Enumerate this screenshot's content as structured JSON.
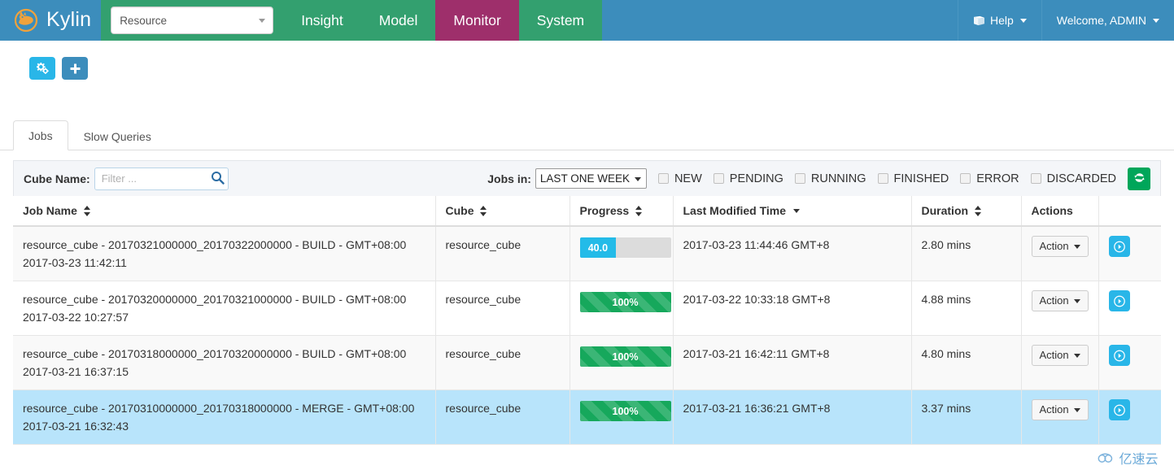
{
  "header": {
    "brand": "Kylin",
    "logo_icon": "kylin-logo-icon",
    "project_selector": {
      "value": "Resource",
      "caret_icon": "chevron-down-icon"
    },
    "nav_links": [
      {
        "label": "Insight",
        "active": false
      },
      {
        "label": "Model",
        "active": false
      },
      {
        "label": "Monitor",
        "active": true
      },
      {
        "label": "System",
        "active": false
      }
    ],
    "help": {
      "label": "Help",
      "icon": "book-icon",
      "caret_icon": "caret-down-icon"
    },
    "user": {
      "label": "Welcome, ADMIN",
      "caret_icon": "caret-down-icon"
    },
    "colors": {
      "navbar_bg": "#3c8dbc",
      "nav_item_bg": "#33a06f",
      "nav_active_bg": "#9e2f6b"
    }
  },
  "toolbar": {
    "buttons": [
      {
        "icon": "cogs-icon",
        "color": "#29b6e8",
        "name": "settings-button"
      },
      {
        "icon": "plus-icon",
        "color": "#3c8dbc",
        "name": "add-button"
      }
    ]
  },
  "tabs": [
    {
      "label": "Jobs",
      "active": true
    },
    {
      "label": "Slow Queries",
      "active": false
    }
  ],
  "filters": {
    "cube_name_label": "Cube Name:",
    "cube_name_value": "",
    "cube_name_placeholder": "Filter ...",
    "search_icon": "search-icon",
    "jobs_in_label": "Jobs in:",
    "jobs_in_value": "LAST ONE WEEK",
    "jobs_in_options": [
      "LAST ONE WEEK"
    ],
    "status_checkboxes": [
      {
        "label": "NEW",
        "checked": false
      },
      {
        "label": "PENDING",
        "checked": false
      },
      {
        "label": "RUNNING",
        "checked": false
      },
      {
        "label": "FINISHED",
        "checked": false
      },
      {
        "label": "ERROR",
        "checked": false
      },
      {
        "label": "DISCARDED",
        "checked": false
      }
    ],
    "refresh_icon": "refresh-icon",
    "refresh_color": "#00a65a"
  },
  "table": {
    "columns": [
      {
        "label": "Job Name",
        "sort": "both"
      },
      {
        "label": "Cube",
        "sort": "both"
      },
      {
        "label": "Progress",
        "sort": "both"
      },
      {
        "label": "Last Modified Time",
        "sort": "desc"
      },
      {
        "label": "Duration",
        "sort": "both"
      },
      {
        "label": "Actions",
        "sort": "none"
      },
      {
        "label": "",
        "sort": "none"
      }
    ],
    "rows": [
      {
        "job_name": "resource_cube - 20170321000000_20170322000000 - BUILD - GMT+08:00 2017-03-23 11:42:11",
        "cube": "resource_cube",
        "progress_label": "40.0",
        "progress_value": 40,
        "progress_style": "cyan",
        "last_modified": "2017-03-23 11:44:46 GMT+8",
        "duration": "2.80 mins",
        "action_label": "Action",
        "drill_icon": "arrow-right-circle-icon",
        "row_style": "alt"
      },
      {
        "job_name": "resource_cube - 20170320000000_20170321000000 - BUILD - GMT+08:00 2017-03-22 10:27:57",
        "cube": "resource_cube",
        "progress_label": "100%",
        "progress_value": 100,
        "progress_style": "green",
        "last_modified": "2017-03-22 10:33:18 GMT+8",
        "duration": "4.88 mins",
        "action_label": "Action",
        "drill_icon": "arrow-right-circle-icon",
        "row_style": "plain"
      },
      {
        "job_name": "resource_cube - 20170318000000_20170320000000 - BUILD - GMT+08:00 2017-03-21 16:37:15",
        "cube": "resource_cube",
        "progress_label": "100%",
        "progress_value": 100,
        "progress_style": "green",
        "last_modified": "2017-03-21 16:42:11 GMT+8",
        "duration": "4.80 mins",
        "action_label": "Action",
        "drill_icon": "arrow-right-circle-icon",
        "row_style": "alt"
      },
      {
        "job_name": "resource_cube - 20170310000000_20170318000000 - MERGE - GMT+08:00 2017-03-21 16:32:43",
        "cube": "resource_cube",
        "progress_label": "100%",
        "progress_value": 100,
        "progress_style": "green",
        "last_modified": "2017-03-21 16:36:21 GMT+8",
        "duration": "3.37 mins",
        "action_label": "Action",
        "drill_icon": "arrow-right-circle-icon",
        "row_style": "selected"
      }
    ]
  },
  "watermark": {
    "text": "亿速云",
    "icon": "cloud-icon"
  }
}
